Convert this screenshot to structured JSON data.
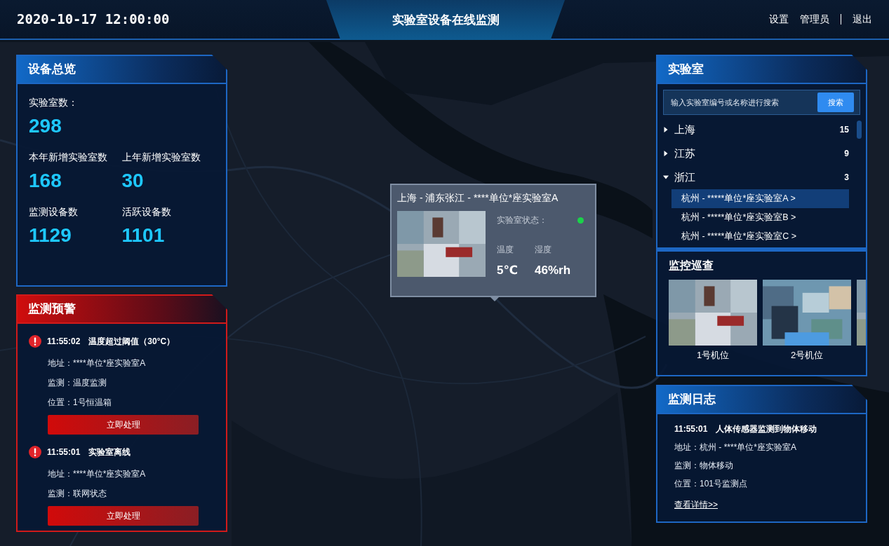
{
  "header": {
    "datetime": "2020-10-17 12:00:00",
    "title": "实验室设备在线监测",
    "links": [
      "设置",
      "管理员",
      "退出"
    ]
  },
  "overview": {
    "title": "设备总览",
    "stats": [
      {
        "kind": "wide",
        "label": "实验室数：",
        "value": "298"
      },
      {
        "kind": "half",
        "label": "本年新增实验室数",
        "value": "168"
      },
      {
        "kind": "half",
        "label": "上年新增实验室数",
        "value": "30"
      },
      {
        "kind": "half",
        "label": "监测设备数",
        "value": "1129"
      },
      {
        "kind": "half",
        "label": "活跃设备数",
        "value": "1101"
      }
    ]
  },
  "alerts": {
    "title": "监测预警",
    "items": [
      {
        "time": "11:55:02",
        "message": "温度超过阈值（30°C）",
        "lines": [
          "地址：****单位*座实验室A",
          "监测：温度监测",
          "位置：1号恒温箱"
        ],
        "action": "立即处理"
      },
      {
        "time": "11:55:01",
        "message": "实验室离线",
        "lines": [
          "地址：****单位*座实验室A",
          "监测：联网状态"
        ],
        "action": "立即处理"
      }
    ]
  },
  "popup": {
    "title": "上海 - 浦东张江 - ****单位*座实验室A",
    "status_label": "实验室状态：",
    "online": true,
    "metrics": [
      {
        "label": "温度",
        "value": "5℃"
      },
      {
        "label": "湿度",
        "value": "46%rh"
      }
    ]
  },
  "labs": {
    "title": "实验室",
    "search": {
      "placeholder": "输入实验室编号或名称进行搜索",
      "button": "搜索"
    },
    "regions": [
      {
        "name": "上海",
        "count": "15",
        "expanded": false
      },
      {
        "name": "江苏",
        "count": "9",
        "expanded": false
      },
      {
        "name": "浙江",
        "count": "3",
        "expanded": true,
        "children": [
          {
            "label": "杭州 - *****单位*座实验室A >",
            "selected": true
          },
          {
            "label": "杭州 - *****单位*座实验室B >",
            "selected": false
          },
          {
            "label": "杭州 - *****单位*座实验室C >",
            "selected": false
          }
        ]
      }
    ]
  },
  "patrol": {
    "title": "监控巡查",
    "cameras": [
      {
        "kind": "camera",
        "label": "1号机位"
      },
      {
        "kind": "camera",
        "label": "2号机位"
      },
      {
        "kind": "picture"
      }
    ]
  },
  "log": {
    "title": "监测日志",
    "entries": [
      {
        "time": "11:55:01",
        "message": "人体传感器监测到物体移动",
        "lines": [
          "地址：杭州 - ****单位*座实验室A",
          "监测：物体移动",
          "位置：101号监测点"
        ]
      }
    ],
    "link": "查看详情>>"
  }
}
